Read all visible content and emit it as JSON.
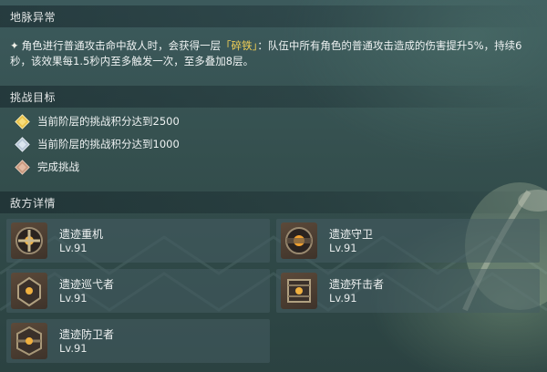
{
  "sections": {
    "anomaly_title": "地脉异常",
    "goals_title": "挑战目标",
    "enemies_title": "敌方详情"
  },
  "anomaly": {
    "bullet": "✦",
    "text_before": "角色进行普通攻击命中敌人时，会获得一层",
    "highlight": "「碎铁」",
    "text_after": "：队伍中所有角色的普通攻击造成的伤害提升5%，持续6秒，该效果每1.5秒内至多触发一次，至多叠加8层。",
    "highlight_color": "#f2cf56"
  },
  "goals": [
    {
      "text": "当前阶层的挑战积分达到2500",
      "icon": "gold-gem-icon",
      "color": "#e9c24a"
    },
    {
      "text": "当前阶层的挑战积分达到1000",
      "icon": "silver-gem-icon",
      "color": "#b9c8d8"
    },
    {
      "text": "完成挑战",
      "icon": "bronze-gem-icon",
      "color": "#c99a80"
    }
  ],
  "enemies": [
    {
      "name": "遗迹重机",
      "level": "Lv.91",
      "icon": "ruin-grader-icon"
    },
    {
      "name": "遗迹守卫",
      "level": "Lv.91",
      "icon": "ruin-guard-icon"
    },
    {
      "name": "遗迹巡弋者",
      "level": "Lv.91",
      "icon": "ruin-cruiser-icon"
    },
    {
      "name": "遗迹歼击者",
      "level": "Lv.91",
      "icon": "ruin-destroyer-icon"
    },
    {
      "name": "遗迹防卫者",
      "level": "Lv.91",
      "icon": "ruin-defender-icon"
    }
  ]
}
